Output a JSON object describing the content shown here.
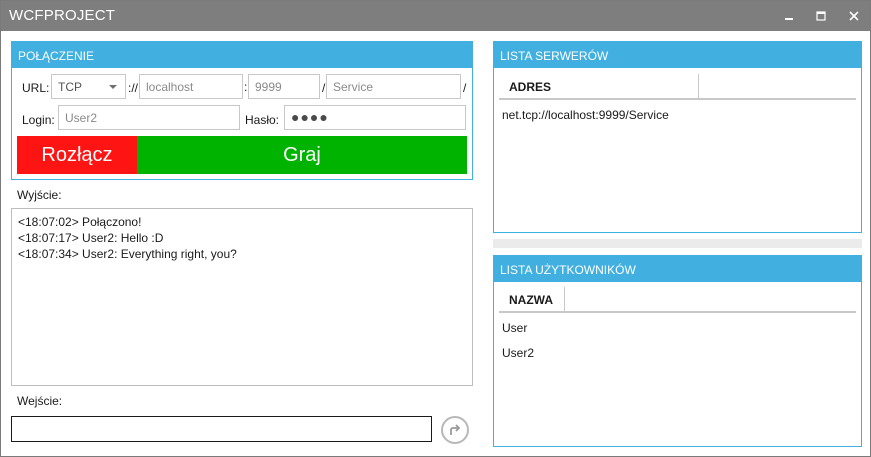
{
  "window": {
    "title": "WCFPROJECT",
    "min_icon": "minimize-icon",
    "max_icon": "maximize-icon",
    "close_icon": "close-icon"
  },
  "connection": {
    "header": "POŁĄCZENIE",
    "url_label": "URL:",
    "protocol": "TCP",
    "sep_scheme": "://",
    "host": "localhost",
    "sep_port": ":",
    "port": "9999",
    "sep_path": "/",
    "service": "Service",
    "sep_end": "/",
    "login_label": "Login:",
    "login_value": "User2",
    "password_label": "Hasło:",
    "password_mask": "●●●●",
    "disconnect_label": "Rozłącz",
    "play_label": "Graj"
  },
  "output": {
    "label": "Wyjście:",
    "lines": [
      "<18:07:02> Połączono!",
      "<18:07:17> User2: Hello :D",
      "<18:07:34> User2: Everything right, you?"
    ]
  },
  "input": {
    "label": "Wejście:",
    "value": "",
    "send_icon": "send-arrow-icon"
  },
  "servers": {
    "header": "LISTA SERWERÓW",
    "column": "ADRES",
    "items": [
      "net.tcp://localhost:9999/Service"
    ]
  },
  "users": {
    "header": "LISTA UŻYTKOWNIKÓW",
    "column": "NAZWA",
    "items": [
      "User",
      "User2"
    ]
  },
  "colors": {
    "accent": "#41b0e0",
    "titlebar": "#7e7e7e",
    "disconnect": "#ff1414",
    "play": "#00b300"
  }
}
